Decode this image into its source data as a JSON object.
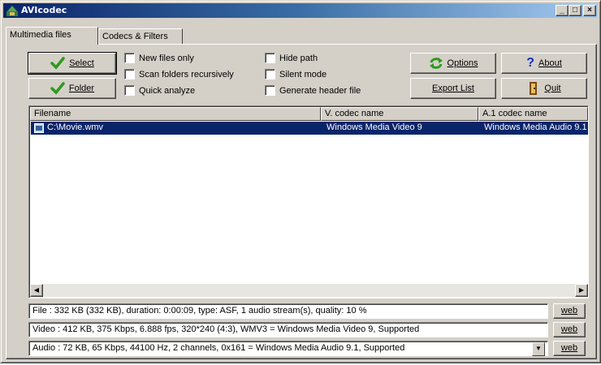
{
  "window": {
    "title": "AVIcodec"
  },
  "tabs": [
    {
      "label": "Multimedia files",
      "underline": "M",
      "active": true
    },
    {
      "label": "Codecs & Filters",
      "underline": "C",
      "active": false
    }
  ],
  "buttons": {
    "select": "Select",
    "folder": "Folder",
    "options": "Options",
    "about": "About",
    "export_list": "Export List",
    "quit": "Quit"
  },
  "checkboxes": {
    "new_files_only": {
      "label": "New files only",
      "checked": false
    },
    "scan_folders": {
      "label": "Scan folders recursively",
      "checked": false
    },
    "quick_analyze": {
      "label": "Quick analyze",
      "checked": false
    },
    "hide_path": {
      "label": "Hide path",
      "checked": false
    },
    "silent_mode": {
      "label": "Silent mode",
      "checked": false
    },
    "generate_header": {
      "label": "Generate header file",
      "checked": false
    }
  },
  "file_list": {
    "columns": [
      "Filename",
      "V. codec name",
      "A.1 codec name"
    ],
    "rows": [
      {
        "filename": "C:\\Movie.wmv",
        "video_codec": "Windows Media Video 9",
        "audio_codec": "Windows Media Audio 9.1",
        "selected": true
      }
    ]
  },
  "info": {
    "file": "File    :  332 KB (332 KB),  duration: 0:00:09,  type: ASF,  1 audio stream(s),  quality: 10 %",
    "video": "Video :  412 KB,  375 Kbps,  6.888 fps,  320*240 (4:3),  WMV3 = Windows Media Video 9,   Supported",
    "audio": "Audio :  72 KB,  65 Kbps,  44100 Hz,  2 channels,  0x161 = Windows Media Audio 9.1,   Supported",
    "web_label": "web"
  },
  "colors": {
    "titlebar_start": "#0a246a",
    "titlebar_end": "#a6caf0",
    "selection": "#0a246a",
    "check_green": "#2e9a1e"
  }
}
